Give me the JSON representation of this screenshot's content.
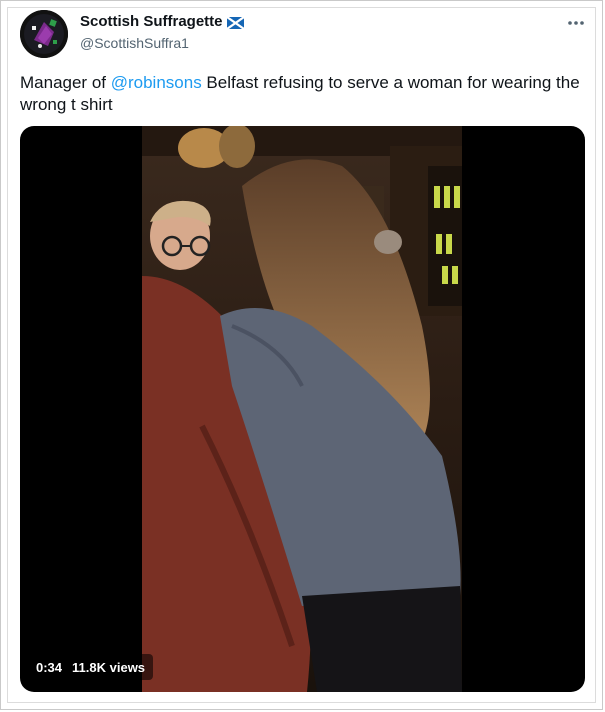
{
  "author": {
    "display_name": "Scottish Suffragette",
    "handle": "@ScottishSuffra1",
    "flag_icon": "scotland-flag-icon"
  },
  "tweet": {
    "text_prefix": "Manager of ",
    "mention": "@robinsons",
    "text_suffix": " Belfast refusing to serve a woman for wearing the wrong t shirt"
  },
  "video": {
    "duration": "0:34",
    "views": "11.8K views"
  },
  "icons": {
    "more": "more-horizontal-icon"
  },
  "colors": {
    "link": "#1d9bf0",
    "secondary_text": "#536471",
    "primary_text": "#0f1419"
  }
}
